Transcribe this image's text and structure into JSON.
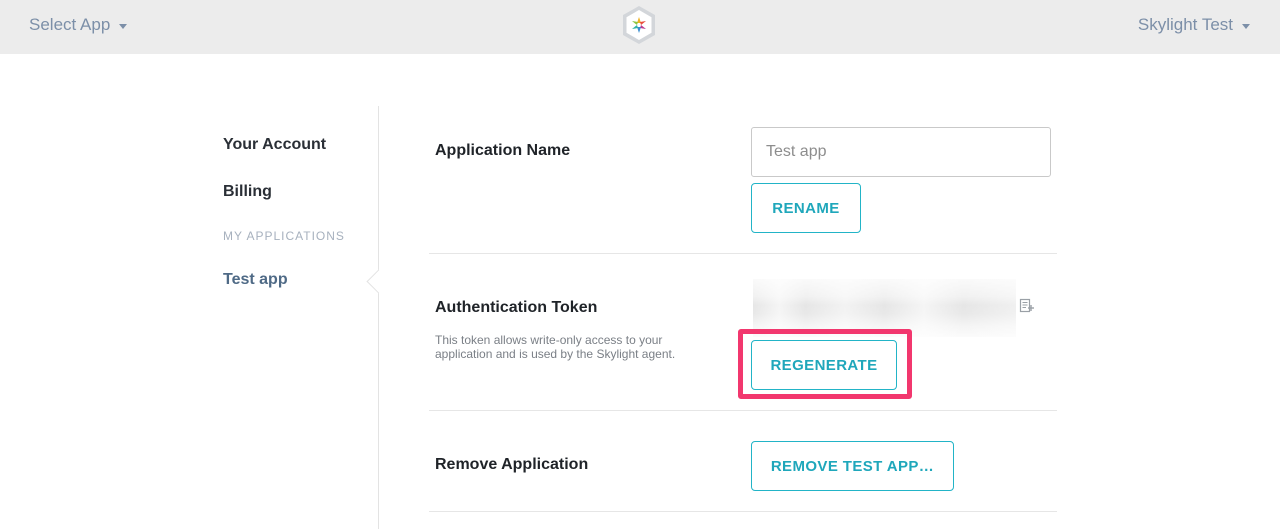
{
  "header": {
    "app_select_label": "Select App",
    "user_menu_label": "Skylight Test"
  },
  "sidebar": {
    "your_account": "Your Account",
    "billing": "Billing",
    "my_applications_heading": "MY APPLICATIONS",
    "apps": [
      "Test app"
    ]
  },
  "application_name": {
    "label": "Application Name",
    "input_placeholder": "Test app",
    "input_value": "",
    "rename_button": "RENAME"
  },
  "authentication_token": {
    "label": "Authentication Token",
    "description": "This token allows write-only access to your application and is used by the Skylight agent.",
    "regenerate_button": "REGENERATE"
  },
  "remove_application": {
    "label": "Remove Application",
    "remove_button": "REMOVE TEST APP…"
  },
  "colors": {
    "accent": "#22b4c7",
    "highlight": "#f2376e",
    "topbar": "#ececec",
    "nav_text": "#7c8fa8"
  },
  "icons": {
    "logo": "skylight-hexagon-logo",
    "copy": "copy-clipboard-icon",
    "dropdown": "chevron-down-icon"
  }
}
